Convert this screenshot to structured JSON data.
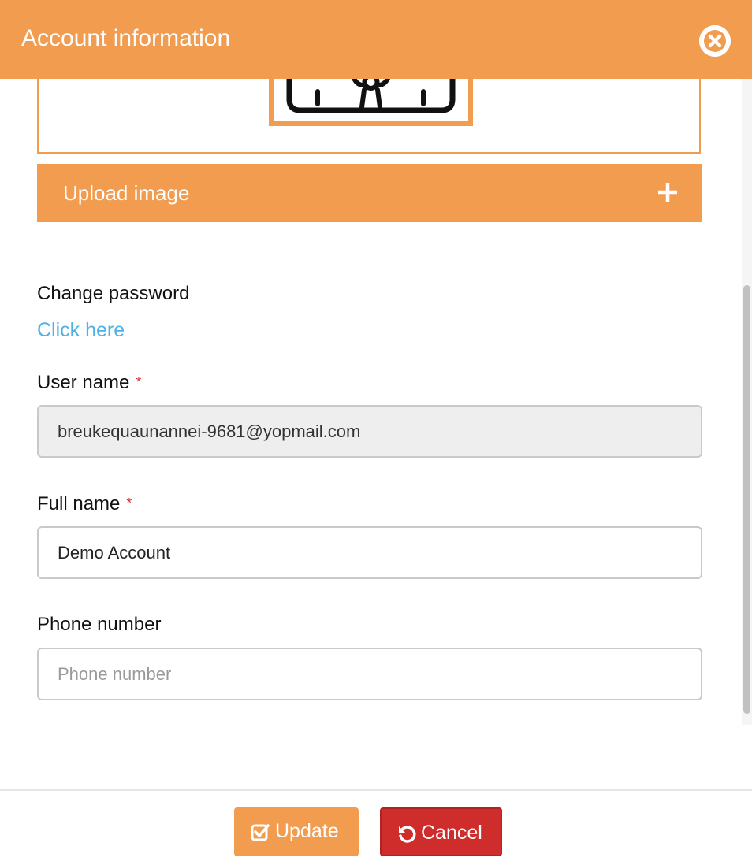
{
  "theme": {
    "accent": "#f29c4f",
    "danger": "#cf2c2c",
    "link": "#4db2e5"
  },
  "header": {
    "title": "Account information",
    "close_icon": "close-circle-icon"
  },
  "image_section": {
    "upload_label": "Upload image",
    "upload_icon": "plus-icon"
  },
  "password": {
    "label": "Change password",
    "link_text": "Click here"
  },
  "fields": {
    "username": {
      "label": "User name",
      "required_mark": "*",
      "value": "breukequaunannei-9681@yopmail.com"
    },
    "fullname": {
      "label": "Full name",
      "required_mark": "*",
      "value": "Demo Account"
    },
    "phone": {
      "label": "Phone number",
      "value": "",
      "placeholder": "Phone number"
    }
  },
  "footer": {
    "update_label": "Update",
    "update_icon": "check-square-icon",
    "cancel_label": "Cancel",
    "cancel_icon": "undo-icon"
  }
}
